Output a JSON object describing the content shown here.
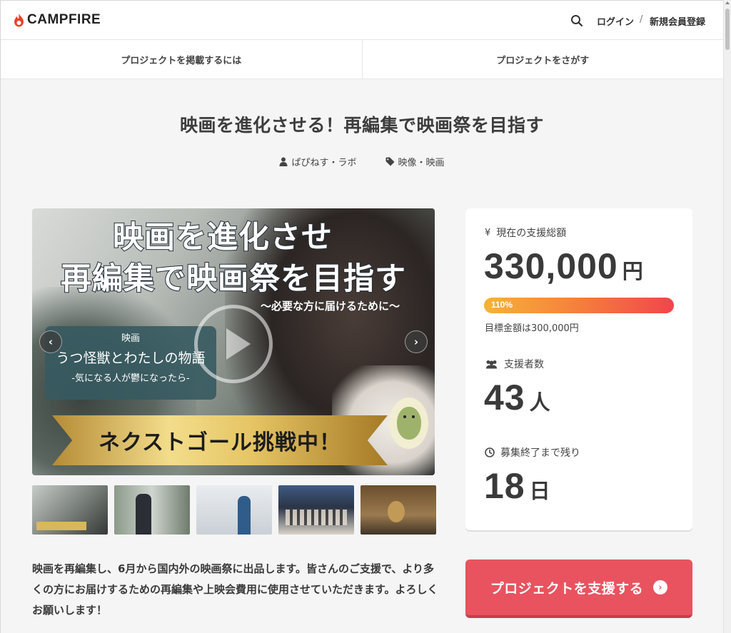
{
  "header": {
    "logo_text": "CAMPFIRE",
    "login_label": "ログイン",
    "separator": "/",
    "register_label": "新規会員登録"
  },
  "nav": {
    "tabs": [
      "プロジェクトを掲載するには",
      "プロジェクトをさがす"
    ]
  },
  "project": {
    "title": "映画を進化させる！再編集で映画祭を目指す",
    "owner": "ぱぴねす・ラボ",
    "category": "映像・映画"
  },
  "media": {
    "headline_1": "映画を進化させ",
    "headline_2": "再編集で映画祭を目指す",
    "subline": "〜必要な方に届けるために〜",
    "box_label": "映画",
    "box_title": "うつ怪獣とわたしの物語",
    "box_subtitle": "-気になる人が鬱になったら-",
    "banner": "ネクストゴール挑戦中！",
    "prev_arrow": "‹",
    "next_arrow": "›"
  },
  "description": "映画を再編集し、6月から国内外の映画祭に出品します。皆さんのご支援で、より多くの方にお届けするための再編集や上映会費用に使用させていただきます。よろしくお願いします！",
  "stats": {
    "total_label": "現在の支援総額",
    "total_value": "330,000",
    "total_unit": "円",
    "progress_percent": 110,
    "progress_label": "110%",
    "goal_text": "目標金額は300,000円",
    "backers_label": "支援者数",
    "backers_value": "43",
    "backers_unit": "人",
    "remaining_label": "募集終了まで残り",
    "remaining_value": "18",
    "remaining_unit": "日"
  },
  "support_button": {
    "label": "プロジェクトを支援する"
  },
  "colors": {
    "brand_flame": "#e8412c",
    "cta": "#e8535f",
    "progress_start": "#f7b239",
    "progress_end": "#f1454c"
  }
}
